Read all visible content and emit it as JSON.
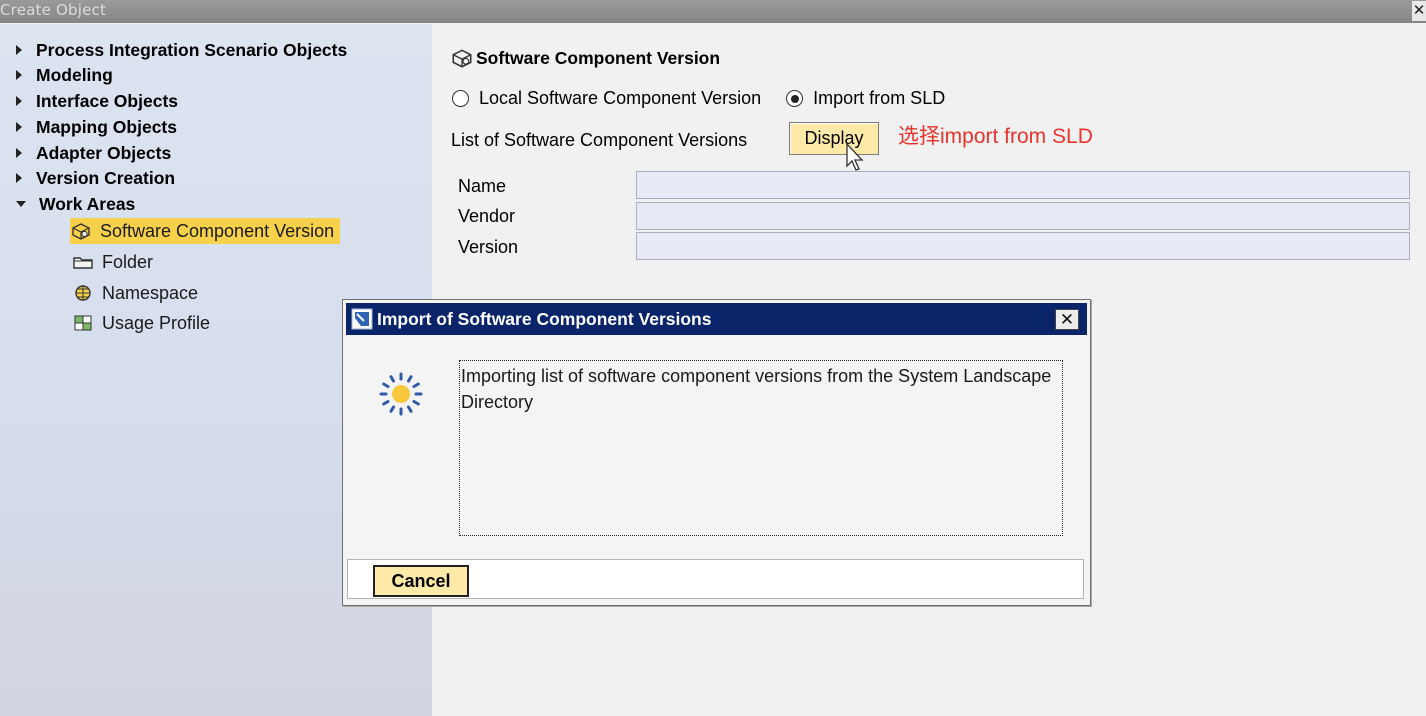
{
  "window": {
    "title": "Create Object",
    "close_glyph": "✕"
  },
  "sidebar": {
    "categories": [
      {
        "label": "Process Integration Scenario Objects",
        "expanded": false
      },
      {
        "label": "Modeling",
        "expanded": false
      },
      {
        "label": "Interface Objects",
        "expanded": false
      },
      {
        "label": "Mapping Objects",
        "expanded": false
      },
      {
        "label": "Adapter Objects",
        "expanded": false
      },
      {
        "label": "Version Creation",
        "expanded": false
      },
      {
        "label": "Work Areas",
        "expanded": true
      }
    ],
    "work_area_items": [
      {
        "label": "Software Component Version",
        "icon": "software-component-icon",
        "selected": true
      },
      {
        "label": "Folder",
        "icon": "folder-icon",
        "selected": false
      },
      {
        "label": "Namespace",
        "icon": "namespace-icon",
        "selected": false
      },
      {
        "label": "Usage Profile",
        "icon": "usage-profile-icon",
        "selected": false
      }
    ],
    "selected_color": "#f7d04c"
  },
  "main": {
    "heading": "Software Component Version",
    "radio_local": "Local Software Component Version",
    "radio_import": "Import from SLD",
    "selected_radio": "import",
    "list_label": "List of Software Component Versions",
    "display_button": "Display",
    "annotation": "选择import from SLD",
    "annotation_color": "#e8342c",
    "fields": [
      {
        "label": "Name",
        "value": ""
      },
      {
        "label": "Vendor",
        "value": ""
      },
      {
        "label": "Version",
        "value": ""
      }
    ]
  },
  "dialog": {
    "title": "Import of Software Component Versions",
    "close_glyph": "✕",
    "message": "Importing list of software component versions from the System Landscape Directory",
    "cancel_button": "Cancel",
    "title_bar_color": "#0a246a"
  }
}
